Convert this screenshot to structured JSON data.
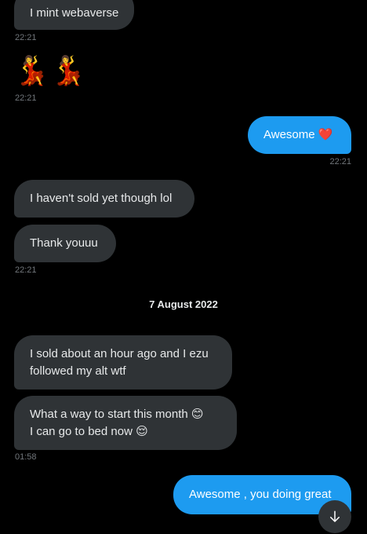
{
  "messages": [
    {
      "text": "I mint webaverse",
      "time": "22:21"
    },
    {
      "emojis": "💃💃",
      "time": "22:21"
    },
    {
      "text": "Awesome",
      "emoji": "❤️",
      "time": "22:21"
    },
    {
      "text": "I haven't sold yet though lol"
    },
    {
      "text": "Thank youuu",
      "time": "22:21"
    },
    {
      "text": "I sold about an hour ago and I ezu\nfollowed my alt wtf"
    },
    {
      "line1": "What a way to start this month",
      "emoji1": "😊",
      "line2": "I can go to bed now",
      "emoji2": "😌",
      "time": "01:58"
    },
    {
      "text": "Awesome , you doing great"
    }
  ],
  "date_separator": "7 August 2022",
  "scroll_button": {
    "icon": "arrow-down-icon"
  }
}
